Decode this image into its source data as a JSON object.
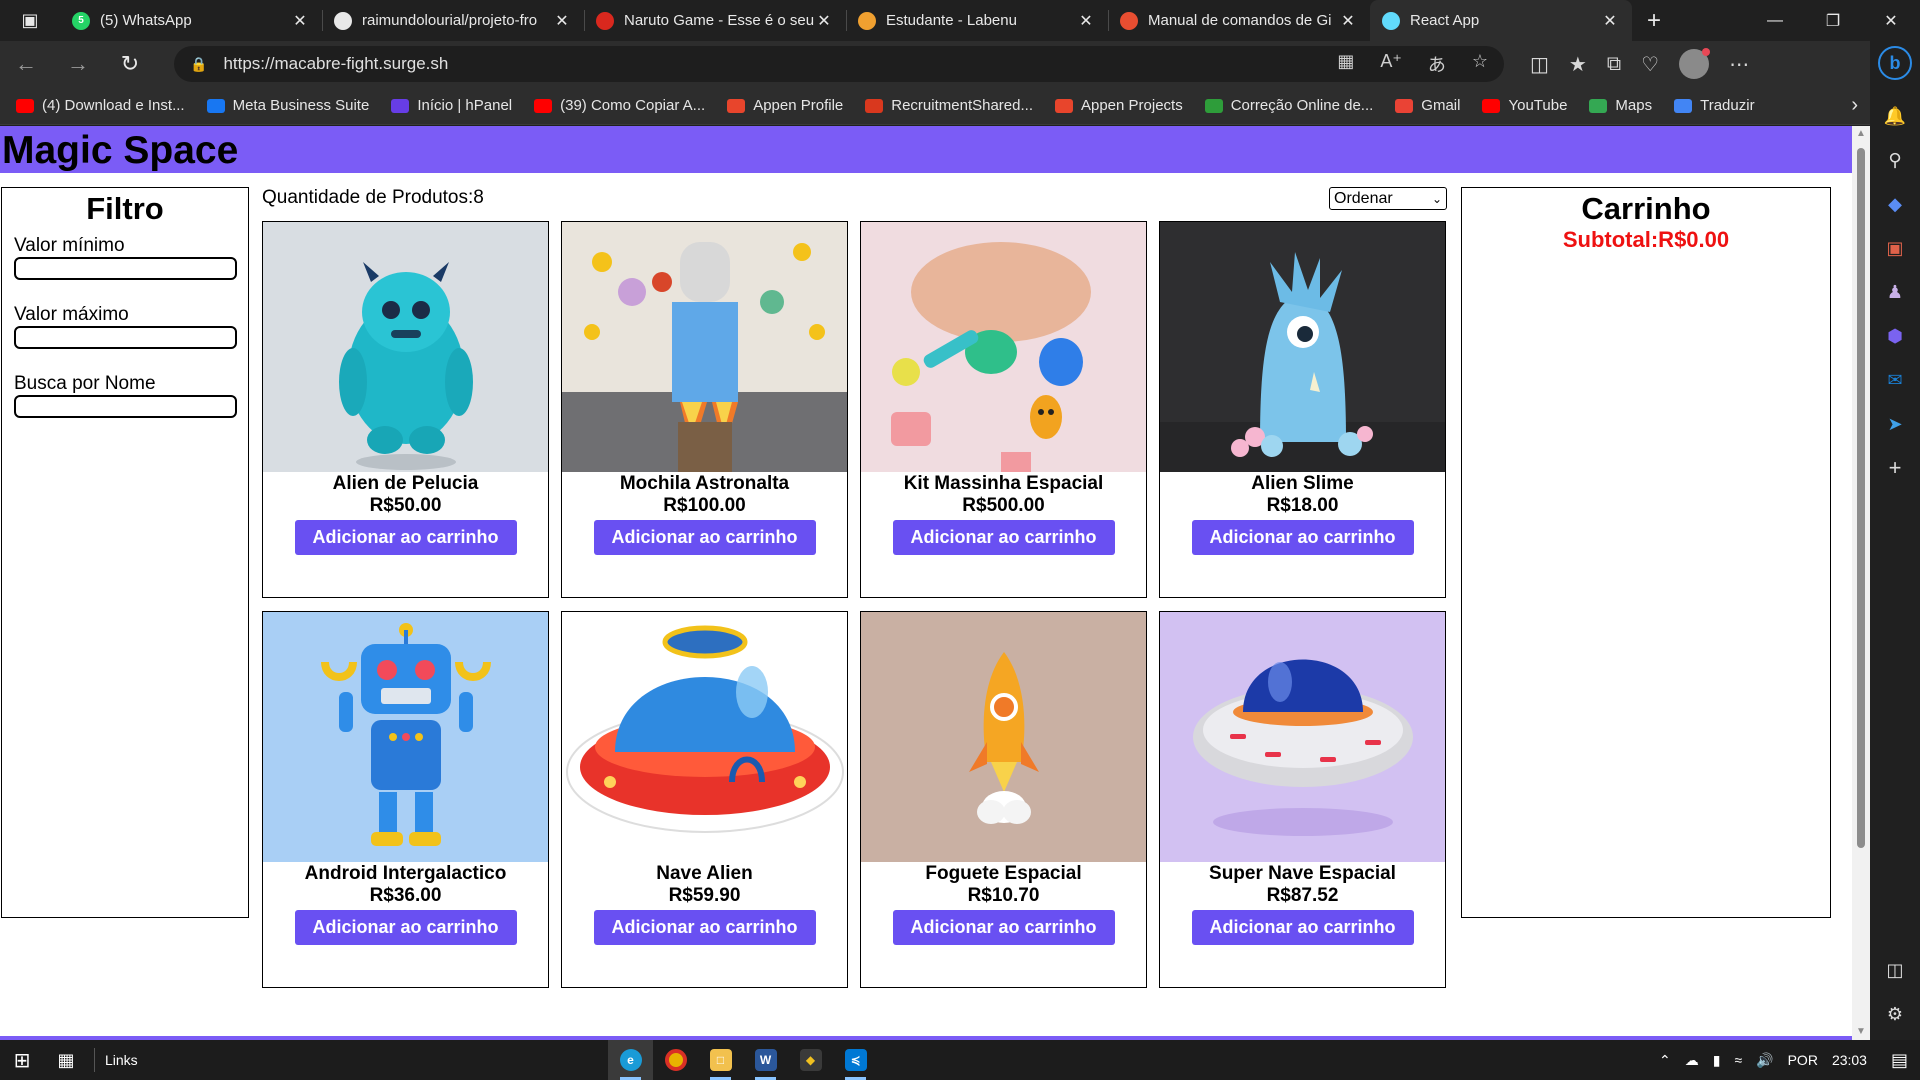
{
  "browser": {
    "tabs": [
      {
        "title": "(5) WhatsApp",
        "icon": "whatsapp-icon",
        "color": "#25d366",
        "glyph": "5"
      },
      {
        "title": "raimundolourial/projeto-fro",
        "icon": "github-icon",
        "color": "#e8e8e8",
        "glyph": ""
      },
      {
        "title": "Naruto Game - Esse é o seu",
        "icon": "naruto-icon",
        "color": "#d9281e",
        "glyph": ""
      },
      {
        "title": "Estudante - Labenu",
        "icon": "labenu-icon",
        "color": "#f0a030",
        "glyph": ""
      },
      {
        "title": "Manual de comandos de Gi",
        "icon": "git-icon",
        "color": "#e84e31",
        "glyph": ""
      },
      {
        "title": "React App",
        "icon": "react-icon",
        "color": "#61dafb",
        "glyph": ""
      }
    ],
    "url": "https://macabre-fight.surge.sh",
    "bookmarks": [
      {
        "label": "(4) Download e Inst...",
        "color": "#ff0000"
      },
      {
        "label": "Meta Business Suite",
        "color": "#1877f2"
      },
      {
        "label": "Início | hPanel",
        "color": "#673de6"
      },
      {
        "label": "(39) Como Copiar A...",
        "color": "#ff0000"
      },
      {
        "label": "Appen Profile",
        "color": "#e8452c"
      },
      {
        "label": "RecruitmentShared...",
        "color": "#d9381e"
      },
      {
        "label": "Appen Projects",
        "color": "#e8452c"
      },
      {
        "label": "Correção Online de...",
        "color": "#2e9d3a"
      },
      {
        "label": "Gmail",
        "color": "#ea4335"
      },
      {
        "label": "YouTube",
        "color": "#ff0000"
      },
      {
        "label": "Maps",
        "color": "#34a853"
      },
      {
        "label": "Traduzir",
        "color": "#4285f4"
      }
    ]
  },
  "site": {
    "title": "Magic Space",
    "accent": "#7b5cf6",
    "button_color": "#6950f2"
  },
  "filter": {
    "heading": "Filtro",
    "min_label": "Valor mínimo",
    "max_label": "Valor máximo",
    "name_label": "Busca por Nome"
  },
  "products": {
    "count_label": "Quantidade de Produtos:8",
    "sort_label": "Ordenar",
    "add_label": "Adicionar ao carrinho",
    "items": [
      {
        "name": "Alien de Pelucia",
        "price": "R$50.00",
        "bg": "#d8dde2",
        "art": "plush"
      },
      {
        "name": "Mochila Astronalta",
        "price": "R$100.00",
        "bg": "#e9e4dc",
        "art": "astronaut"
      },
      {
        "name": "Kit Massinha Espacial",
        "price": "R$500.00",
        "bg": "#f0dce0",
        "art": "clay"
      },
      {
        "name": "Alien Slime",
        "price": "R$18.00",
        "bg": "#2e2e30",
        "art": "slime"
      },
      {
        "name": "Android Intergalactico",
        "price": "R$36.00",
        "bg": "#a9cff5",
        "art": "robot"
      },
      {
        "name": "Nave Alien",
        "price": "R$59.90",
        "bg": "#ffffff",
        "art": "ufo"
      },
      {
        "name": "Foguete Espacial",
        "price": "R$10.70",
        "bg": "#c9b0a3",
        "art": "rocket"
      },
      {
        "name": "Super Nave Espacial",
        "price": "R$87.52",
        "bg": "#d2c1f2",
        "art": "ufo2"
      }
    ]
  },
  "cart": {
    "heading": "Carrinho",
    "subtotal": "Subtotal:R$0.00",
    "subtotal_color": "#ee1111"
  },
  "taskbar": {
    "links_label": "Links",
    "lang": "POR",
    "time": "23:03"
  }
}
